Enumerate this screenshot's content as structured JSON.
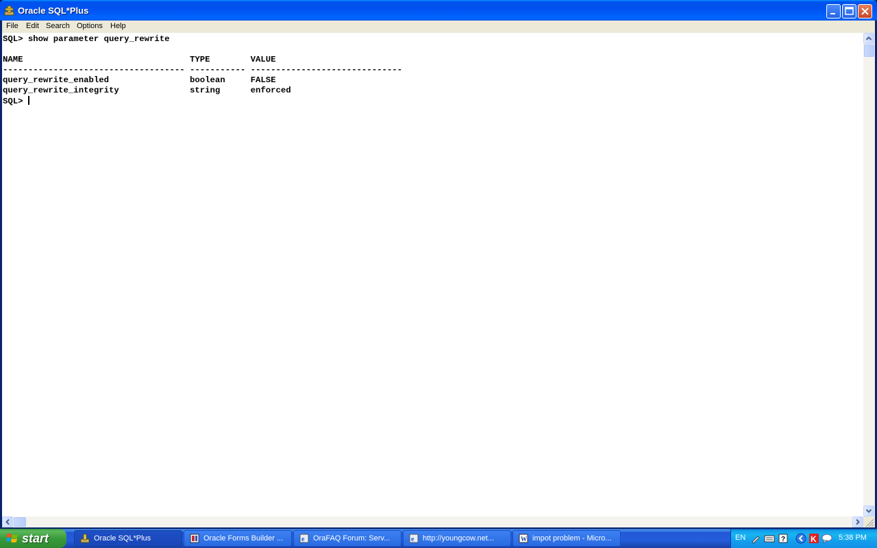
{
  "window": {
    "title": "Oracle SQL*Plus"
  },
  "menu": {
    "items": [
      "File",
      "Edit",
      "Search",
      "Options",
      "Help"
    ]
  },
  "console": {
    "lines": [
      "SQL> show parameter query_rewrite",
      "",
      "NAME                                 TYPE        VALUE",
      "------------------------------------ ----------- ------------------------------",
      "query_rewrite_enabled                boolean     FALSE",
      "query_rewrite_integrity              string      enforced",
      "SQL> "
    ]
  },
  "taskbar": {
    "start_label": "start",
    "tasks": [
      {
        "label": "Oracle SQL*Plus",
        "active": true
      },
      {
        "label": "Oracle Forms Builder ...",
        "active": false
      },
      {
        "label": "OraFAQ Forum: Serv...",
        "active": false
      },
      {
        "label": "http://youngcow.net...",
        "active": false
      },
      {
        "label": "impot problem - Micro...",
        "active": false
      }
    ],
    "tray": {
      "language": "EN",
      "clock": "5:38 PM"
    }
  },
  "colors": {
    "titlebar": "#0053ee",
    "taskbar": "#245edb",
    "start": "#3a9a3a",
    "tray": "#18b5f2",
    "console_bg": "#ffffff",
    "menubar": "#ece9d8"
  }
}
